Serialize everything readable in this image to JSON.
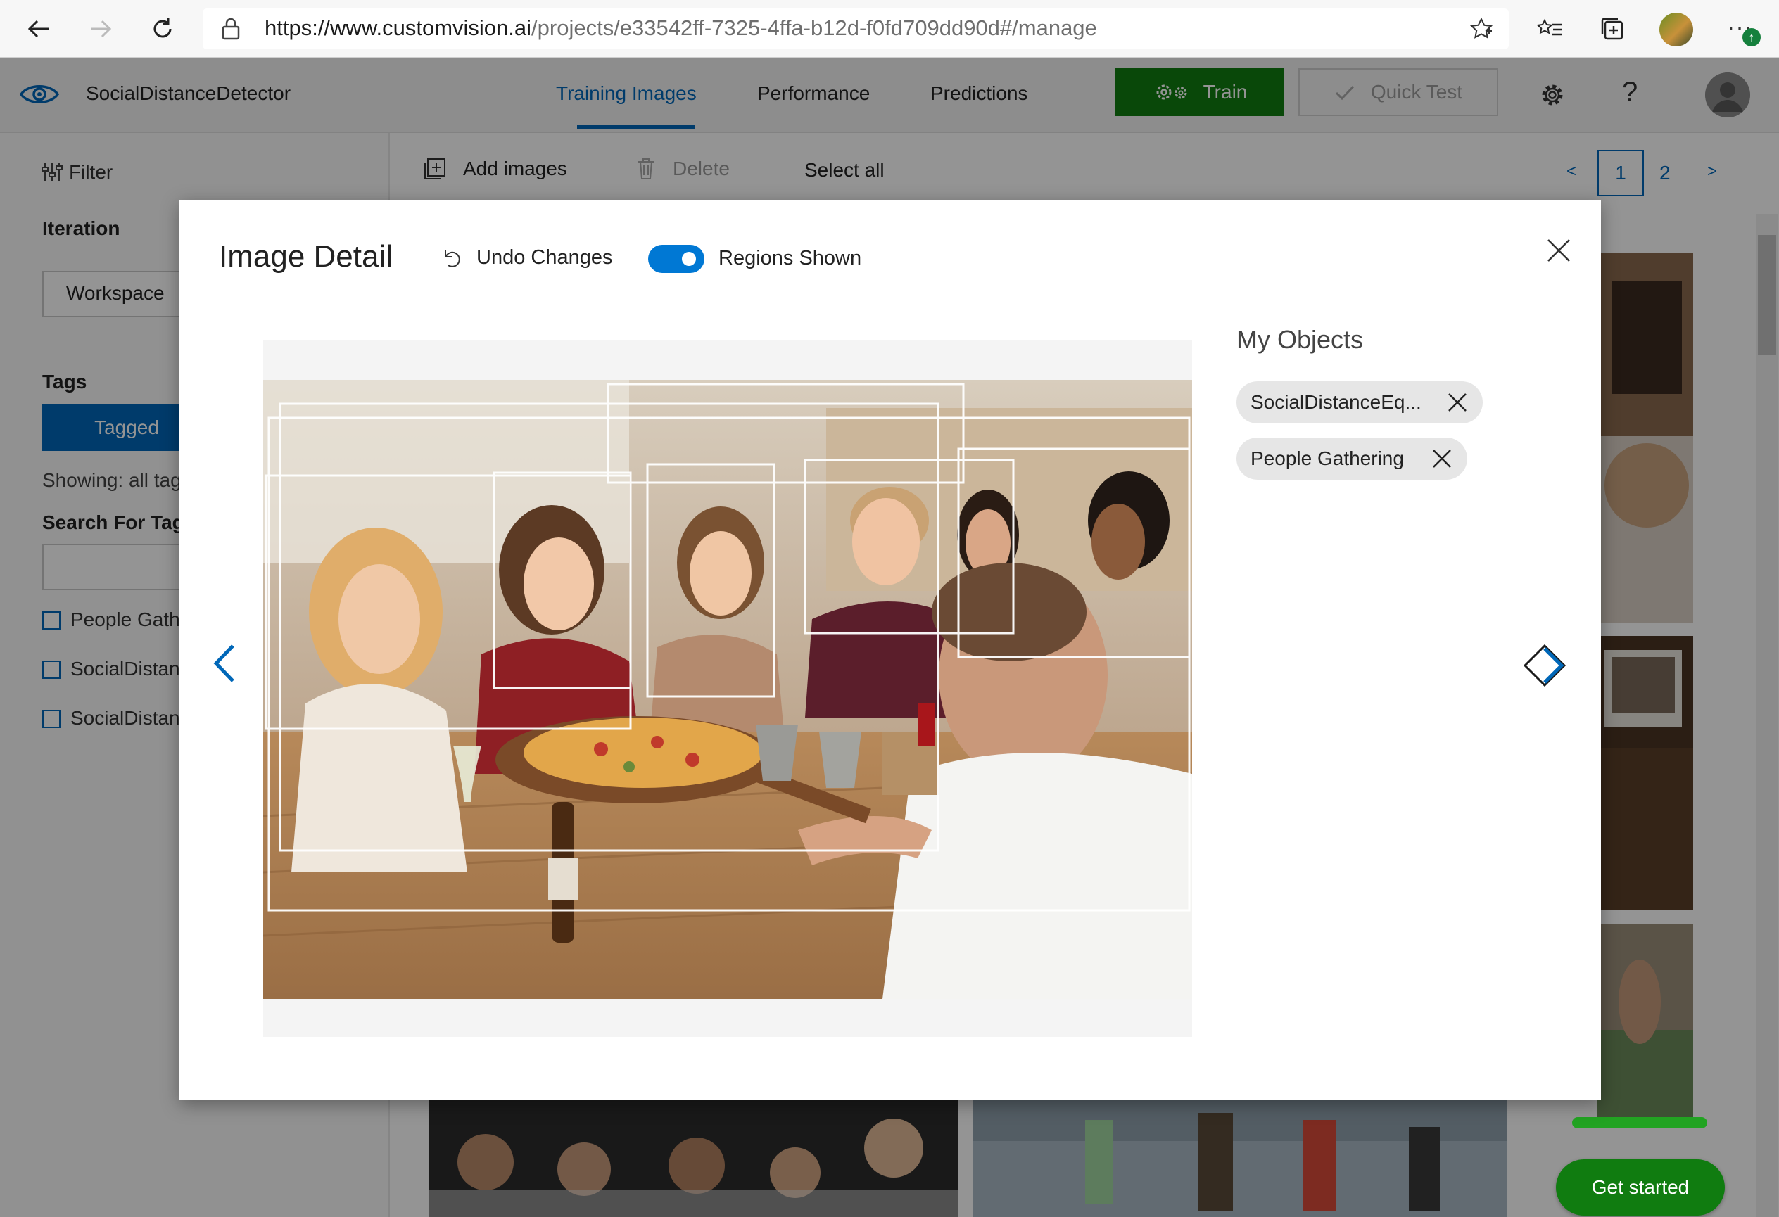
{
  "browser": {
    "url_host": "https://www.customvision.ai",
    "url_path": "/projects/e33542ff-7325-4ffa-b12d-f0fd709dd90d#/manage",
    "more_label": "···"
  },
  "header": {
    "project_name": "SocialDistanceDetector",
    "tabs": [
      {
        "label": "Training Images",
        "active": true
      },
      {
        "label": "Performance",
        "active": false
      },
      {
        "label": "Predictions",
        "active": false
      }
    ],
    "train_label": "Train",
    "quick_test_label": "Quick Test",
    "help_label": "?"
  },
  "sidebar": {
    "filter_label": "Filter",
    "iteration_heading": "Iteration",
    "iteration_value": "Workspace",
    "tags_heading": "Tags",
    "tagged_button": "Tagged",
    "showing_text": "Showing: all tags",
    "search_heading": "Search For Tags",
    "tag_items": [
      {
        "label": "People Gathering"
      },
      {
        "label": "SocialDistanceEq..."
      },
      {
        "label": "SocialDistance..."
      }
    ]
  },
  "toolbar": {
    "add_images": "Add images",
    "delete": "Delete",
    "select_all": "Select all",
    "pager_prev": "<",
    "pager_pages": [
      "1",
      "2"
    ],
    "pager_current": "1",
    "pager_next": ">"
  },
  "get_started": "Get started",
  "modal": {
    "title": "Image Detail",
    "undo_label": "Undo Changes",
    "regions_label": "Regions Shown",
    "regions_shown": true,
    "objects_title": "My Objects",
    "objects": [
      {
        "label": "SocialDistanceEq..."
      },
      {
        "label": "People Gathering"
      }
    ]
  },
  "colors": {
    "accent": "#0067b8",
    "train_green": "#107c10",
    "toggle_on": "#0078d4"
  },
  "icons": {
    "back": "arrow-left-icon",
    "forward": "arrow-right-icon",
    "refresh": "refresh-icon",
    "lock": "lock-icon",
    "favorite": "star-icon",
    "favorites": "favorites-icon",
    "collections": "collections-icon",
    "brand": "eye-icon",
    "settings": "gear-icon",
    "filter": "filter-icon",
    "add": "add-image-icon",
    "delete": "trash-icon",
    "undo": "undo-icon",
    "close": "close-icon",
    "prev_image": "chevron-left-icon",
    "next_image": "chevron-right-icon"
  }
}
